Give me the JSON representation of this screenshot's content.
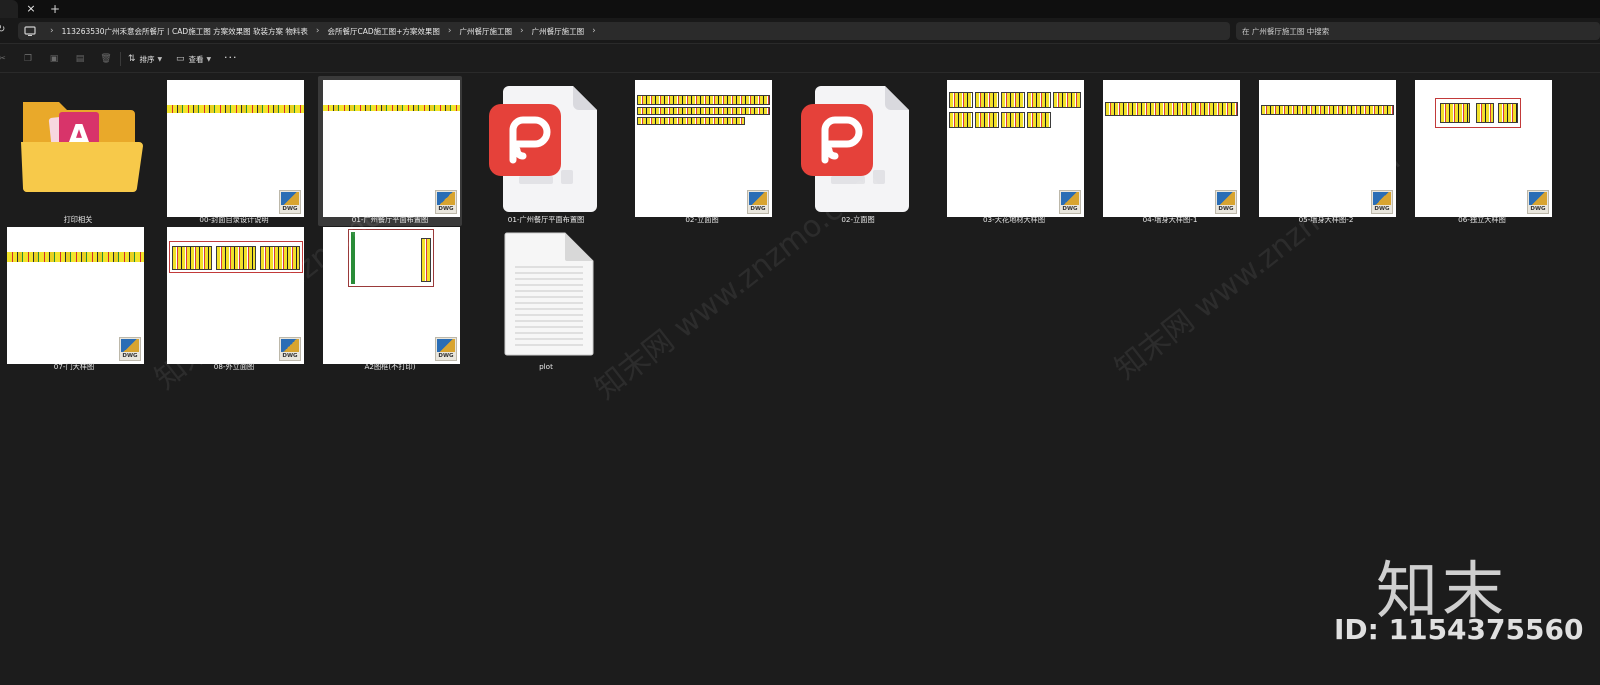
{
  "tabs": {
    "close_glyph": "×",
    "new_glyph": "+"
  },
  "address": {
    "breadcrumbs": [
      "113263530广州禾意会所餐厅丨CAD施工图 方案效果图 软装方案 物料表",
      "会所餐厅CAD施工图+方案效果图",
      "广州餐厅施工图",
      "广州餐厅施工图"
    ],
    "search_placeholder": "在 广州餐厅施工图 中搜索"
  },
  "toolbar": {
    "sort_label": "排序",
    "view_label": "查看",
    "more_label": "···"
  },
  "items": [
    {
      "label": "打印相关",
      "kind": "folder"
    },
    {
      "label": "00-封面目录设计说明",
      "kind": "dwg"
    },
    {
      "label": "01-广州餐厅平面布置图",
      "kind": "dwg",
      "selected": true
    },
    {
      "label": "01-广州餐厅平面布置图",
      "kind": "pdf"
    },
    {
      "label": "02-立面图",
      "kind": "dwg"
    },
    {
      "label": "02-立面图",
      "kind": "pdf"
    },
    {
      "label": "03-天花地材大样图",
      "kind": "dwg"
    },
    {
      "label": "04-墙身大样图-1",
      "kind": "dwg"
    },
    {
      "label": "05-墙身大样图-2",
      "kind": "dwg"
    },
    {
      "label": "06-独立大样图",
      "kind": "dwg"
    },
    {
      "label": "07-门大样图",
      "kind": "dwg"
    },
    {
      "label": "08-外立面图",
      "kind": "dwg"
    },
    {
      "label": "A2图框(不打印)",
      "kind": "dwg"
    },
    {
      "label": "plot",
      "kind": "text"
    }
  ],
  "badge_text": "DWG",
  "watermark": {
    "text": "知末网 www.znzmo.com",
    "short": "知末网"
  },
  "brand": {
    "logo": "知末",
    "id": "ID: 1154375560"
  },
  "colors": {
    "pdf_red": "#e5413a",
    "cad_yellow": "#f3e52a",
    "folder": "#f3c13a"
  }
}
